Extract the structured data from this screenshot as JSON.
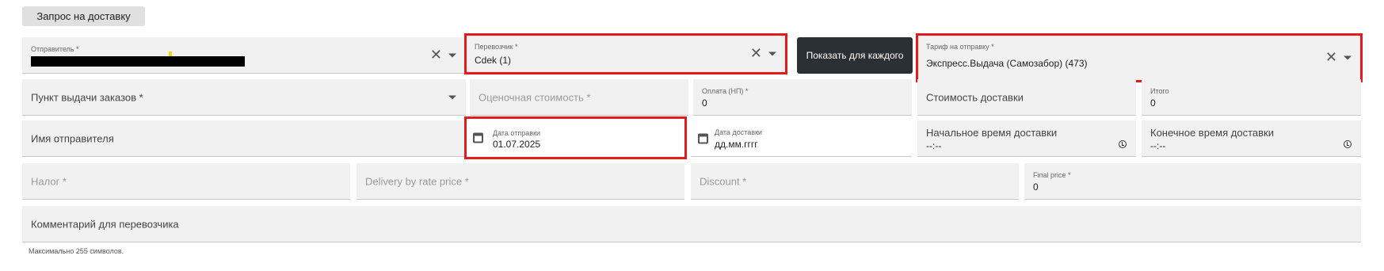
{
  "tab": {
    "label": "Запрос на доставку"
  },
  "sender": {
    "label": "Отправитель *"
  },
  "carrier": {
    "label": "Перевозчик *",
    "value": "Cdek (1)"
  },
  "show_each_button": {
    "label": "Показать для каждого"
  },
  "tariff": {
    "label": "Тариф на отправку *",
    "value": "Экспресс.Выдача (Самозабор) (473)"
  },
  "pickup_point": {
    "label": "Пункт выдачи заказов *"
  },
  "declared_value": {
    "placeholder": "Оценочная стоимость *"
  },
  "cod_payment": {
    "label": "Оплата (НП) *",
    "value": "0"
  },
  "delivery_cost": {
    "label": "Стоимость доставки"
  },
  "total": {
    "label": "Итого",
    "value": "0"
  },
  "sender_name": {
    "label": "Имя отправителя"
  },
  "ship_date": {
    "label": "Дата отправки",
    "value": "01.07.2025"
  },
  "delivery_date": {
    "label": "Дата доставки",
    "value": "дд.мм.гггг"
  },
  "start_time": {
    "label": "Начальное время доставки",
    "value": "--:--"
  },
  "end_time": {
    "label": "Конечное время доставки",
    "value": "--:--"
  },
  "tax": {
    "placeholder": "Налог *"
  },
  "delivery_rate_price": {
    "placeholder": "Delivery by rate price *"
  },
  "discount": {
    "placeholder": "Discount *"
  },
  "final_price": {
    "label": "Final price *",
    "value": "0"
  },
  "comment": {
    "label": "Комментарий для перевозчика",
    "helper": "Максимально 255 символов."
  },
  "colors": {
    "highlight": "#e11c1c",
    "field_bg": "#f1f1f1",
    "button_dark": "#2b3035"
  }
}
